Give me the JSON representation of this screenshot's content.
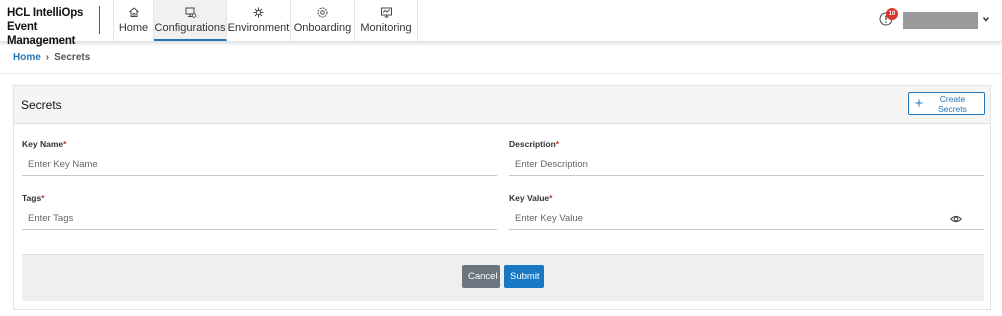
{
  "brand": {
    "line1": "HCL IntelliOps",
    "line2": "Event Management"
  },
  "nav": {
    "tabs": [
      {
        "label": "Home",
        "icon": "home-icon"
      },
      {
        "label": "Configurations",
        "icon": "configurations-icon",
        "active": true
      },
      {
        "label": "Environment",
        "icon": "environment-icon"
      },
      {
        "label": "Onboarding",
        "icon": "onboarding-icon"
      },
      {
        "label": "Monitoring",
        "icon": "monitoring-icon"
      }
    ]
  },
  "header_right": {
    "notification_count": "10"
  },
  "breadcrumb": {
    "home": "Home",
    "separator": "›",
    "current": "Secrets"
  },
  "card": {
    "title": "Secrets",
    "create_button": "Create Secrets"
  },
  "form": {
    "key_name": {
      "label": "Key Name",
      "required": "*",
      "placeholder": "Enter Key Name",
      "value": ""
    },
    "description": {
      "label": "Description",
      "required": "*",
      "placeholder": "Enter Description",
      "value": ""
    },
    "tags": {
      "label": "Tags",
      "required": "*",
      "placeholder": "Enter Tags",
      "value": ""
    },
    "key_value": {
      "label": "Key Value",
      "required": "*",
      "placeholder": "Enter Key Value",
      "value": ""
    }
  },
  "actions": {
    "cancel": "Cancel",
    "submit": "Submit"
  },
  "colors": {
    "accent": "#1f76b8",
    "submit": "#1878c4",
    "cancel": "#6a7580",
    "badge": "#d9342b"
  }
}
